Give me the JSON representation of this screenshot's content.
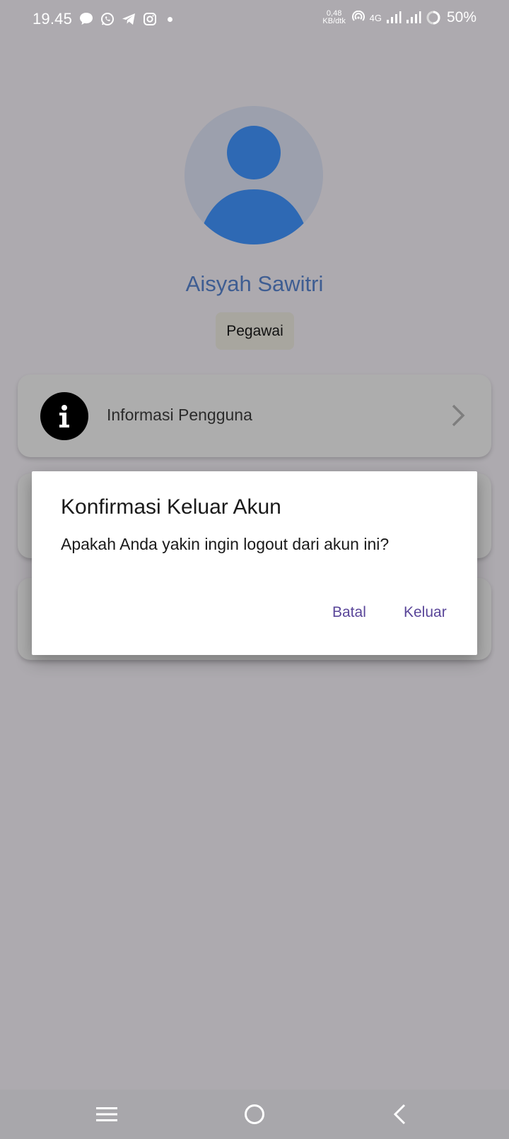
{
  "status_bar": {
    "time": "19.45",
    "net_speed_value": "0,48",
    "net_speed_unit": "KB/dtk",
    "network_type": "4G",
    "battery": "50%",
    "notification_icons": [
      "message-icon",
      "whatsapp-icon",
      "telegram-icon",
      "instagram-icon"
    ]
  },
  "profile": {
    "name": "Aisyah Sawitri",
    "role": "Pegawai"
  },
  "menu": {
    "items": [
      {
        "label": "Informasi Pengguna",
        "icon": "info-icon"
      }
    ]
  },
  "dialog": {
    "title": "Konfirmasi Keluar Akun",
    "message": "Apakah Anda yakin ingin logout dari akun ini?",
    "cancel_label": "Batal",
    "confirm_label": "Keluar"
  },
  "colors": {
    "accent": "#5a4699",
    "name": "#3e5d92",
    "avatar_figure": "#2e69b4",
    "scrim": "#adaaaf"
  },
  "navbar": {
    "buttons": [
      "menu-icon",
      "home-icon",
      "back-icon"
    ]
  }
}
